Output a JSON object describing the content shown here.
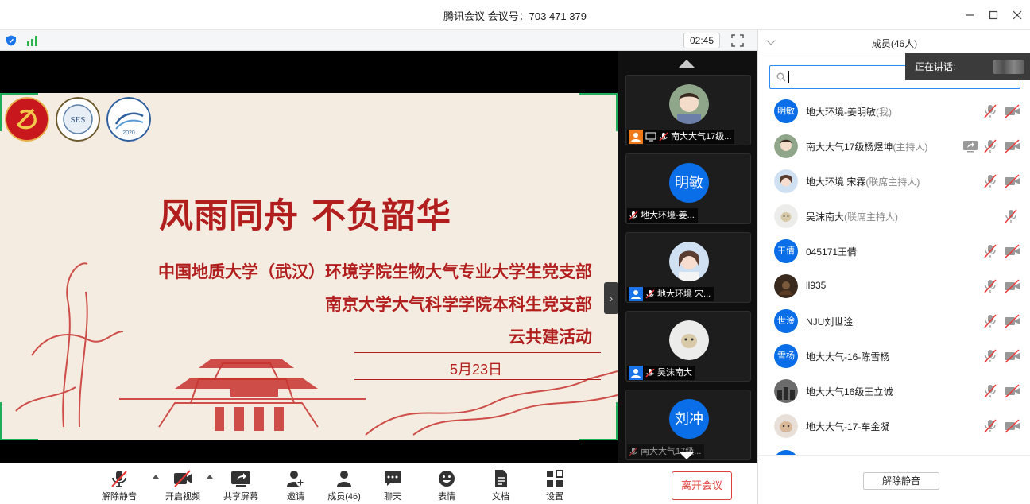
{
  "window": {
    "title": "腾讯会议 会议号：703 471 379",
    "controls": [
      "minimize",
      "maximize",
      "close"
    ]
  },
  "status": {
    "timer": "02:45"
  },
  "slide": {
    "title": "风雨同舟 不负韶华",
    "lines": [
      "中国地质大学（武汉）环境学院生物大气专业大学生党支部",
      "南京大学大气科学学院本科生党支部",
      "云共建活动"
    ],
    "date": "5月23日",
    "logo_texts": [
      "SES",
      "2020"
    ]
  },
  "thumbnails": [
    {
      "caption": "南大大气17级...",
      "avatar_type": "photo"
    },
    {
      "caption": "地大环境-姜...",
      "avatar_text": "明敏"
    },
    {
      "caption": "地大环境 宋...",
      "avatar_type": "photo"
    },
    {
      "caption": "吴沫南大",
      "avatar_type": "photo"
    },
    {
      "caption": "南大大气17级...",
      "avatar_text": "刘冲"
    }
  ],
  "toolbar": {
    "unmute": "解除静音",
    "video": "开启视频",
    "share": "共享屏幕",
    "invite": "邀请",
    "members": "成员(46)",
    "chat": "聊天",
    "reaction": "表情",
    "docs": "文档",
    "settings": "设置",
    "leave": "离开会议"
  },
  "panel": {
    "title": "成员(46人)",
    "speaking_label": "正在讲话:",
    "members": [
      {
        "avatar_text": "明敏",
        "name": "地大环境-姜明敏",
        "role": "(我)"
      },
      {
        "avatar_type": "photo",
        "name": "南大大气17级杨煜坤",
        "role": "(主持人)",
        "sharing": true
      },
      {
        "avatar_type": "photo",
        "name": "地大环境 宋霖",
        "role": "(联席主持人)"
      },
      {
        "avatar_type": "photo",
        "name": "吴沫南大",
        "role": "(联席主持人)",
        "no_video_icon": true
      },
      {
        "avatar_text": "王倩",
        "name": "045171王倩",
        "role": ""
      },
      {
        "avatar_type": "photo",
        "name": "ll935",
        "role": ""
      },
      {
        "avatar_text": "世淦",
        "name": "NJU刘世淦",
        "role": ""
      },
      {
        "avatar_text": "雪杨",
        "name": "地大大气-16-陈雪杨",
        "role": ""
      },
      {
        "avatar_type": "photo",
        "name": "地大大气16级王立诚",
        "role": ""
      },
      {
        "avatar_type": "photo",
        "name": "地大大气-17-车金凝",
        "role": ""
      }
    ],
    "unmute_all": "解除静音"
  },
  "colors": {
    "accent_blue": "#0a6ee8",
    "leave_red": "#e0403a",
    "slide_red": "#b21e1e",
    "frame_green": "#1fae5a"
  }
}
